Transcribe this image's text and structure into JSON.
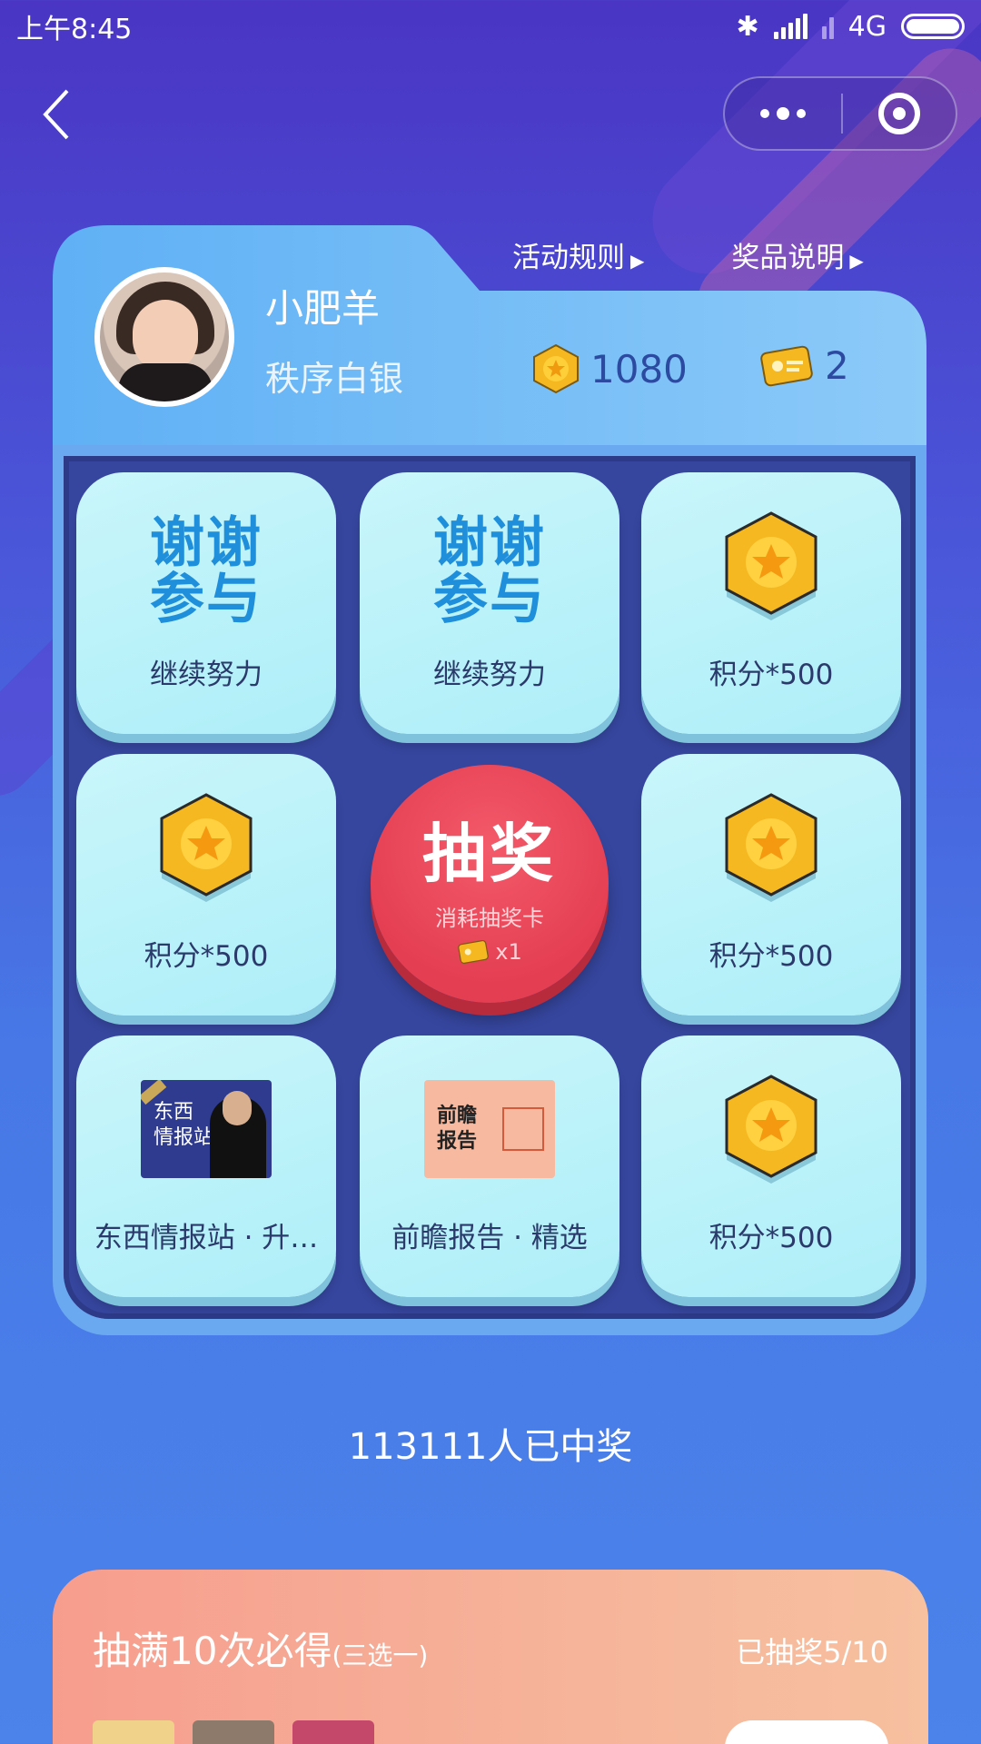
{
  "status_bar": {
    "time": "上午8:45",
    "network": "4G"
  },
  "header": {
    "links": [
      {
        "label": "活动规则"
      },
      {
        "label": "奖品说明"
      }
    ],
    "user": {
      "name": "小肥羊",
      "level": "秩序白银"
    },
    "points": "1080",
    "cards": "2"
  },
  "grid": {
    "tiles": [
      {
        "type": "thanks",
        "title": "谢谢\n参与",
        "label": "继续努力"
      },
      {
        "type": "thanks",
        "title": "谢谢\n参与",
        "label": "继续努力"
      },
      {
        "type": "points",
        "label": "积分*500"
      },
      {
        "type": "points",
        "label": "积分*500"
      },
      {
        "type": "points",
        "label": "积分*500"
      },
      {
        "type": "course",
        "label": "东西情报站 · 升…",
        "thumb_text": "东西\n情报站"
      },
      {
        "type": "course",
        "label": "前瞻报告 · 精选",
        "thumb_text": "前瞻\n报告"
      },
      {
        "type": "points",
        "label": "积分*500"
      }
    ],
    "draw_button": {
      "label": "抽奖",
      "sub": "消耗抽奖卡",
      "cost": "x1"
    }
  },
  "winners_text": "113111人已中奖",
  "bottom_card": {
    "title": "抽满10次必得",
    "title_suffix": "(三选一)",
    "progress_text": "已抽奖5/10"
  },
  "colors": {
    "accent_blue": "#1f8fdc",
    "draw_red": "#e43e52",
    "coin_gold": "#f5b820"
  }
}
